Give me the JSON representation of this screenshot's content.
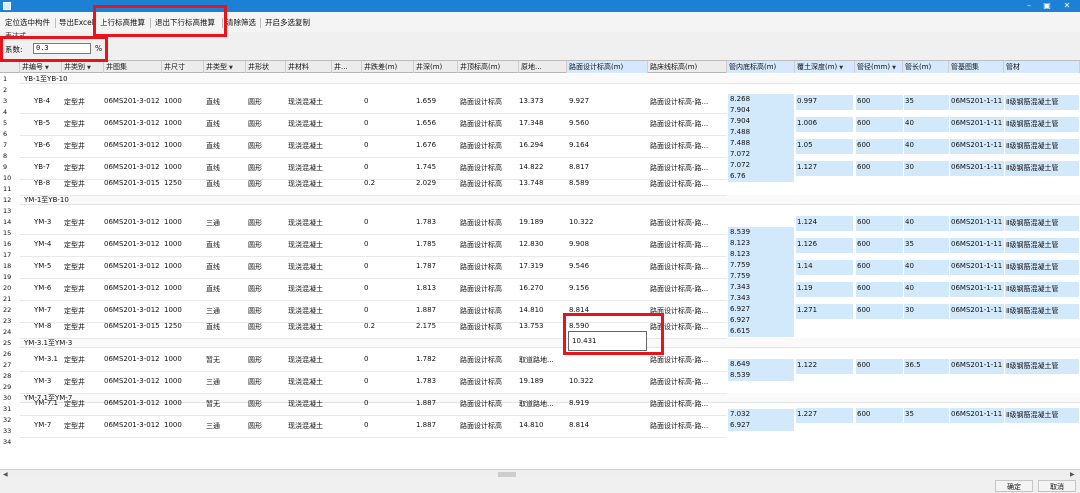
{
  "window": {
    "minimize_glyph": "–",
    "restore_glyph": "▣",
    "close_glyph": "✕"
  },
  "toolbar": {
    "locate_label": "定位选中构件",
    "export_label": "导出Excel",
    "calc_up_label": "上行标高推算",
    "exit_calc_label": "退出下行标高推算",
    "clear_filter_label": "清除筛选",
    "multi_copy_label": "开启多选复制"
  },
  "formula_label": "表达式",
  "coef": {
    "label": "系数:",
    "value": "0.3",
    "unit": "%"
  },
  "columns": [
    "井编号",
    "井类别",
    "井图集",
    "井尺寸",
    "井类型",
    "井形状",
    "井材料",
    "井...",
    "井跌差(m)",
    "井深(m)",
    "井顶标高(m)",
    "原地...",
    "路面设计标高(m)",
    "路床线标高(m)",
    "管内底标高(m)",
    "覆土深度(m)",
    "管径(mm)",
    "管长(m)",
    "管基图集",
    "管材"
  ],
  "row_numbers": [
    "1",
    "2",
    "3",
    "4",
    "5",
    "6",
    "7",
    "8",
    "9",
    "10",
    "11",
    "12",
    "13",
    "14",
    "15",
    "16",
    "17",
    "18",
    "19",
    "20",
    "21",
    "22",
    "23",
    "24",
    "25",
    "26",
    "27",
    "28",
    "29",
    "30",
    "31",
    "32",
    "33",
    "34"
  ],
  "groups": [
    {
      "title": "YB-1至YB-10"
    },
    {
      "title": "YM-1至YB-10"
    },
    {
      "title": "YM-3.1至YM-3"
    },
    {
      "title": "YM-7.1至YM-7"
    }
  ],
  "wells": [
    {
      "id": "YB-4",
      "cat": "定型井",
      "atlas": "06MS201-3-012",
      "size": "1000",
      "type": "直线",
      "shape": "圆形",
      "mat": "现浇混凝土",
      "drop": "0",
      "depth": "1.659",
      "top": "路面设计标高",
      "orig": "13.373",
      "road": "9.927",
      "bed": "路面设计标高-路..."
    },
    {
      "id": "YB-5",
      "cat": "定型井",
      "atlas": "06MS201-3-012",
      "size": "1000",
      "type": "直线",
      "shape": "圆形",
      "mat": "现浇混凝土",
      "drop": "0",
      "depth": "1.656",
      "top": "路面设计标高",
      "orig": "17.348",
      "road": "9.560",
      "bed": "路面设计标高-路..."
    },
    {
      "id": "YB-6",
      "cat": "定型井",
      "atlas": "06MS201-3-012",
      "size": "1000",
      "type": "直线",
      "shape": "圆形",
      "mat": "现浇混凝土",
      "drop": "0",
      "depth": "1.676",
      "top": "路面设计标高",
      "orig": "16.294",
      "road": "9.164",
      "bed": "路面设计标高-路..."
    },
    {
      "id": "YB-7",
      "cat": "定型井",
      "atlas": "06MS201-3-012",
      "size": "1000",
      "type": "直线",
      "shape": "圆形",
      "mat": "现浇混凝土",
      "drop": "0",
      "depth": "1.745",
      "top": "路面设计标高",
      "orig": "14.822",
      "road": "8.817",
      "bed": "路面设计标高-路..."
    },
    {
      "id": "YB-8",
      "cat": "定型井",
      "atlas": "06MS201-3-015",
      "size": "1250",
      "type": "直线",
      "shape": "圆形",
      "mat": "现浇混凝土",
      "drop": "0.2",
      "depth": "2.029",
      "top": "路面设计标高",
      "orig": "13.748",
      "road": "8.589",
      "bed": "路面设计标高-路..."
    },
    {
      "id": "YM-3",
      "cat": "定型井",
      "atlas": "06MS201-3-012",
      "size": "1000",
      "type": "三通",
      "shape": "圆形",
      "mat": "现浇混凝土",
      "drop": "0",
      "depth": "1.783",
      "top": "路面设计标高",
      "orig": "19.189",
      "road": "10.322",
      "bed": "路面设计标高-路..."
    },
    {
      "id": "YM-4",
      "cat": "定型井",
      "atlas": "06MS201-3-012",
      "size": "1000",
      "type": "直线",
      "shape": "圆形",
      "mat": "现浇混凝土",
      "drop": "0",
      "depth": "1.785",
      "top": "路面设计标高",
      "orig": "12.830",
      "road": "9.908",
      "bed": "路面设计标高-路..."
    },
    {
      "id": "YM-5",
      "cat": "定型井",
      "atlas": "06MS201-3-012",
      "size": "1000",
      "type": "直线",
      "shape": "圆形",
      "mat": "现浇混凝土",
      "drop": "0",
      "depth": "1.787",
      "top": "路面设计标高",
      "orig": "17.319",
      "road": "9.546",
      "bed": "路面设计标高-路..."
    },
    {
      "id": "YM-6",
      "cat": "定型井",
      "atlas": "06MS201-3-012",
      "size": "1000",
      "type": "直线",
      "shape": "圆形",
      "mat": "现浇混凝土",
      "drop": "0",
      "depth": "1.813",
      "top": "路面设计标高",
      "orig": "16.270",
      "road": "9.156",
      "bed": "路面设计标高-路..."
    },
    {
      "id": "YM-7",
      "cat": "定型井",
      "atlas": "06MS201-3-012",
      "size": "1000",
      "type": "三通",
      "shape": "圆形",
      "mat": "现浇混凝土",
      "drop": "0",
      "depth": "1.887",
      "top": "路面设计标高",
      "orig": "14.810",
      "road": "8.814",
      "bed": "路面设计标高-路..."
    },
    {
      "id": "YM-8",
      "cat": "定型井",
      "atlas": "06MS201-3-015",
      "size": "1250",
      "type": "直线",
      "shape": "圆形",
      "mat": "现浇混凝土",
      "drop": "0.2",
      "depth": "2.175",
      "top": "路面设计标高",
      "orig": "13.753",
      "road": "8.590",
      "bed": "路面设计标高-路..."
    },
    {
      "id": "YM-3.1",
      "cat": "定型井",
      "atlas": "06MS201-3-012",
      "size": "1000",
      "type": "暂无",
      "shape": "圆形",
      "mat": "现浇混凝土",
      "drop": "0",
      "depth": "1.782",
      "top": "路面设计标高",
      "orig": "取道路地...",
      "road": "",
      "bed": "路面设计标高-路..."
    },
    {
      "id": "YM-3",
      "cat": "定型井",
      "atlas": "06MS201-3-012",
      "size": "1000",
      "type": "三通",
      "shape": "圆形",
      "mat": "现浇混凝土",
      "drop": "0",
      "depth": "1.783",
      "top": "路面设计标高",
      "orig": "19.189",
      "road": "10.322",
      "bed": "路面设计标高-路..."
    },
    {
      "id": "YM-7.1",
      "cat": "定型井",
      "atlas": "06MS201-3-012",
      "size": "1000",
      "type": "暂无",
      "shape": "圆形",
      "mat": "现浇混凝土",
      "drop": "0",
      "depth": "1.887",
      "top": "路面设计标高",
      "orig": "取道路地...",
      "road": "8.919",
      "bed": "路面设计标高-路..."
    },
    {
      "id": "YM-7",
      "cat": "定型井",
      "atlas": "06MS201-3-012",
      "size": "1000",
      "type": "三通",
      "shape": "圆形",
      "mat": "现浇混凝土",
      "drop": "0",
      "depth": "1.887",
      "top": "路面设计标高",
      "orig": "14.810",
      "road": "8.814",
      "bed": "路面设计标高-路..."
    }
  ],
  "edit_value": "10.431",
  "invert_values": [
    "8.268",
    "7.904",
    "7.904",
    "7.488",
    "7.488",
    "7.072",
    "7.072",
    "6.76",
    "8.539",
    "8.123",
    "8.123",
    "7.759",
    "7.759",
    "7.343",
    "7.343",
    "6.927",
    "6.927",
    "6.615",
    "8.649",
    "8.539",
    "7.032",
    "6.927"
  ],
  "pipes": [
    {
      "cover": "0.997",
      "dia": "600",
      "len": "35",
      "base": "06MS201-1-11",
      "mat": "Ⅱ级钢筋混凝土管"
    },
    {
      "cover": "1.006",
      "dia": "600",
      "len": "40",
      "base": "06MS201-1-11",
      "mat": "Ⅱ级钢筋混凝土管"
    },
    {
      "cover": "1.05",
      "dia": "600",
      "len": "40",
      "base": "06MS201-1-11",
      "mat": "Ⅱ级钢筋混凝土管"
    },
    {
      "cover": "1.127",
      "dia": "600",
      "len": "30",
      "base": "06MS201-1-11",
      "mat": "Ⅱ级钢筋混凝土管"
    },
    {
      "cover": "1.124",
      "dia": "600",
      "len": "40",
      "base": "06MS201-1-11",
      "mat": "Ⅱ级钢筋混凝土管"
    },
    {
      "cover": "1.126",
      "dia": "600",
      "len": "35",
      "base": "06MS201-1-11",
      "mat": "Ⅱ级钢筋混凝土管"
    },
    {
      "cover": "1.14",
      "dia": "600",
      "len": "40",
      "base": "06MS201-1-11",
      "mat": "Ⅱ级钢筋混凝土管"
    },
    {
      "cover": "1.19",
      "dia": "600",
      "len": "40",
      "base": "06MS201-1-11",
      "mat": "Ⅱ级钢筋混凝土管"
    },
    {
      "cover": "1.271",
      "dia": "600",
      "len": "30",
      "base": "06MS201-1-11",
      "mat": "Ⅱ级钢筋混凝土管"
    },
    {
      "cover": "1.122",
      "dia": "600",
      "len": "36.5",
      "base": "06MS201-1-11",
      "mat": "Ⅱ级钢筋混凝土管"
    },
    {
      "cover": "1.227",
      "dia": "600",
      "len": "35",
      "base": "06MS201-1-11",
      "mat": "Ⅱ级钢筋混凝土管"
    }
  ],
  "scroll": {
    "left_arrow": "◀",
    "right_arrow": "▶"
  },
  "footer": {
    "ok_label": "确定",
    "cancel_label": "取消"
  }
}
